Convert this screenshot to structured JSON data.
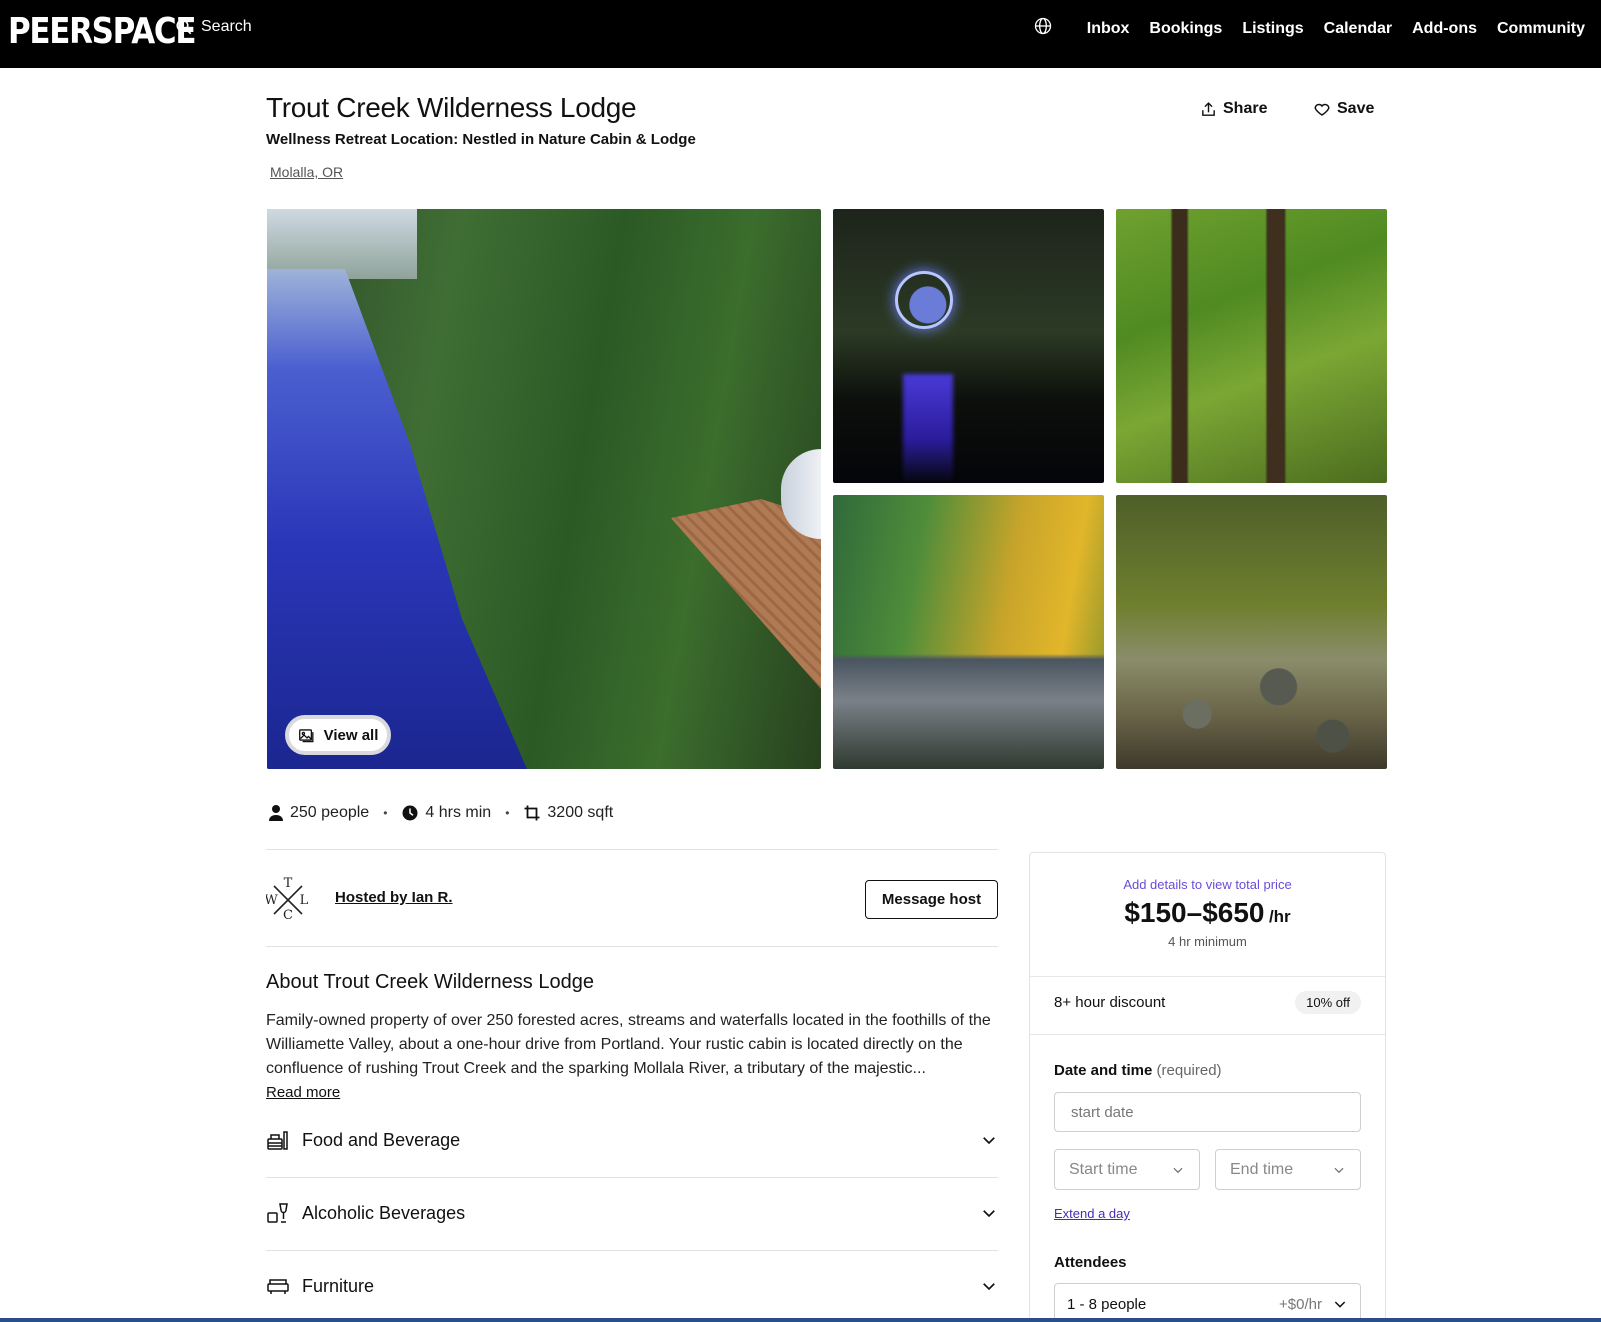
{
  "header": {
    "logo": "PEERSPACE",
    "search_label": "Search",
    "nav": [
      "Inbox",
      "Bookings",
      "Listings",
      "Calendar",
      "Add-ons",
      "Community"
    ]
  },
  "listing": {
    "title": "Trout Creek Wilderness Lodge",
    "subtitle": "Wellness Retreat Location: Nestled in Nature Cabin & Lodge",
    "location": "Molalla, OR",
    "share_label": "Share",
    "save_label": "Save",
    "view_all_label": "View all"
  },
  "stats": {
    "capacity": "250 people",
    "minimum": "4 hrs min",
    "area": "3200 sqft"
  },
  "host": {
    "name": "Hosted by Ian R.",
    "message_button": "Message host"
  },
  "about": {
    "title": "About Trout Creek Wilderness Lodge",
    "text": "Family-owned property of over 250 forested acres, streams and waterfalls located in the foothills of the Williamette Valley, about a one-hour drive from Portland. Your rustic cabin is located directly on the confluence of rushing Trout Creek and the sparking Mollala River, a tributary of the majestic...",
    "read_more": "Read more"
  },
  "amenities": [
    "Food and Beverage",
    "Alcoholic Beverages",
    "Furniture"
  ],
  "booking": {
    "price_note": "Add details to view total price",
    "price": "$150–$650",
    "per": "/hr",
    "minimum": "4 hr minimum",
    "discount_label": "8+ hour discount",
    "discount_badge": "10% off",
    "date_label": "Date and time",
    "date_required": "(required)",
    "start_date_placeholder": "start date",
    "start_time": "Start time",
    "end_time": "End time",
    "extend": "Extend a day",
    "attendees_label": "Attendees",
    "attendees_value": "1 - 8 people",
    "attendees_extra": "+$0/hr"
  },
  "colors": {
    "header_bg": "#000000",
    "accent_purple": "#6b4bd6",
    "link_purple": "#4a2ab8"
  }
}
